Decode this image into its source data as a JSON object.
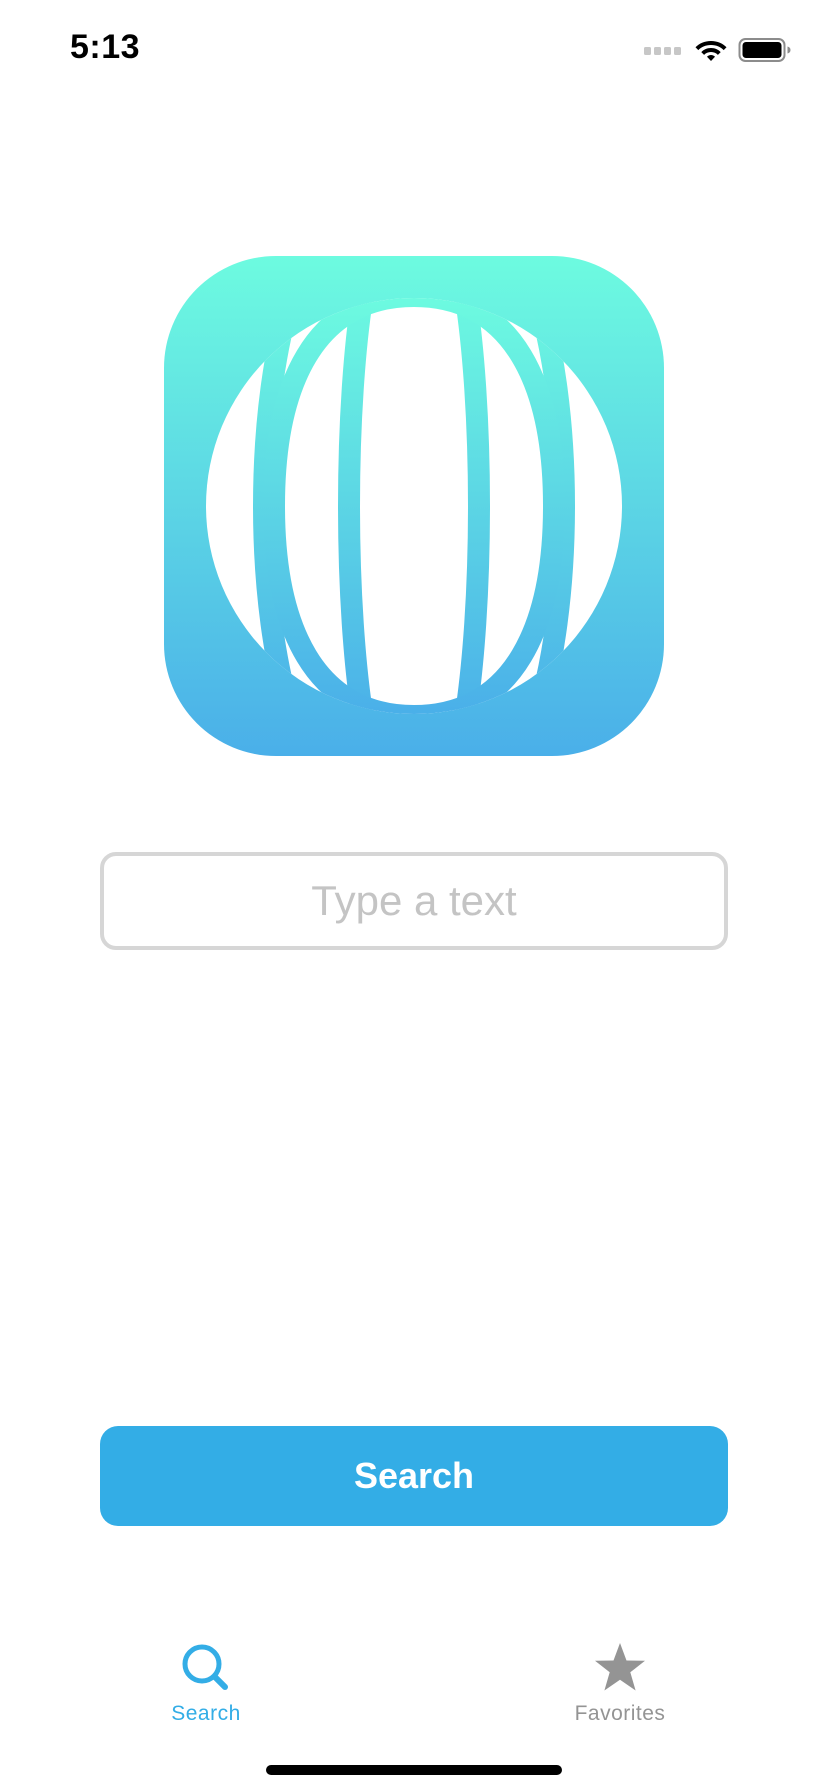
{
  "status_bar": {
    "time": "5:13",
    "icons": [
      "cellular-signal-icon",
      "wifi-icon",
      "battery-icon"
    ]
  },
  "logo": {
    "icon": "globe-icon",
    "gradient_top": "#6dfbe0",
    "gradient_bottom": "#4aafe9"
  },
  "text_input": {
    "placeholder": "Type a text",
    "value": ""
  },
  "search_button": {
    "label": "Search",
    "color": "#33ade6"
  },
  "tab_bar": {
    "tabs": [
      {
        "label": "Search",
        "icon": "search-icon",
        "active": true
      },
      {
        "label": "Favorites",
        "icon": "star-icon",
        "active": false
      }
    ],
    "active_color": "#33ade6",
    "inactive_color": "#949494"
  }
}
